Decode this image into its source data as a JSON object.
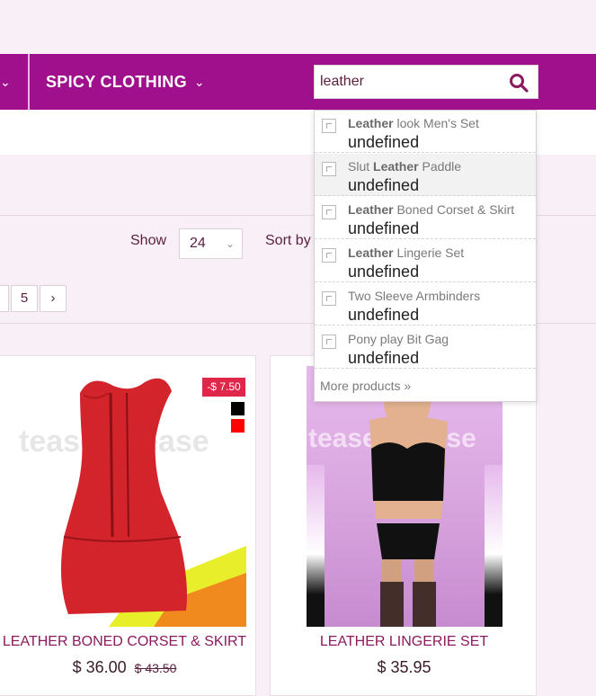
{
  "nav": {
    "left_chevron": "⌄",
    "menu_item": "SPICY CLOTHING",
    "menu_chevron": "⌄"
  },
  "search": {
    "value": "leather",
    "icon": "search-icon"
  },
  "toolbar": {
    "show_label": "Show",
    "show_value": "24",
    "sort_label": "Sort by"
  },
  "pagination": {
    "prev": "‹",
    "page": "5",
    "next": "›"
  },
  "autocomplete": {
    "items": [
      {
        "bold": "Leather",
        "before": "",
        "after": " look Men's Set",
        "sub": "undefined"
      },
      {
        "bold": "Leather",
        "before": "Slut ",
        "after": " Paddle",
        "sub": "undefined"
      },
      {
        "bold": "Leather",
        "before": "",
        "after": " Boned Corset & Skirt",
        "sub": "undefined"
      },
      {
        "bold": "Leather",
        "before": "",
        "after": " Lingerie Set",
        "sub": "undefined"
      },
      {
        "bold": "",
        "before": "Two Sleeve Armbinders",
        "after": "",
        "sub": "undefined"
      },
      {
        "bold": "",
        "before": "Pony play Bit Gag",
        "after": "",
        "sub": "undefined"
      }
    ],
    "more": "More products »"
  },
  "products": [
    {
      "title": "LEATHER BONED CORSET & SKIRT",
      "price": "$ 36.00",
      "old_price": "$ 43.50",
      "discount": "-$ 7.50",
      "watermark": "tease2please",
      "swatches": [
        "#000000",
        "#ff0000"
      ]
    },
    {
      "title": "LEATHER LINGERIE SET",
      "price": "$ 35.95",
      "watermark": "tease2please"
    }
  ],
  "colors": {
    "brand": "#a1108c",
    "background": "#f9eff7",
    "discount": "#e02749"
  }
}
